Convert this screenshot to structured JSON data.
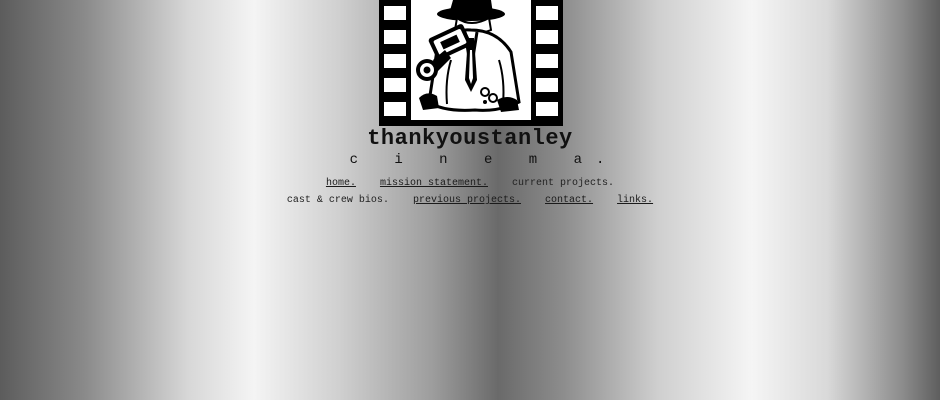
{
  "brand": {
    "title": "thankyoustanley",
    "subtitle": "c i n e m a."
  },
  "logo": {
    "icon": "film-strip-cameraman-logo"
  },
  "nav": {
    "row1": [
      {
        "label": "home.",
        "link": true
      },
      {
        "label": "mission statement.",
        "link": true
      },
      {
        "label": "current projects.",
        "link": false
      }
    ],
    "row2": [
      {
        "label": "cast & crew bios.",
        "link": false
      },
      {
        "label": "previous projects.",
        "link": true
      },
      {
        "label": "contact.",
        "link": true
      },
      {
        "label": "links.",
        "link": true
      }
    ]
  },
  "colors": {
    "text": "#111111",
    "logo_black": "#000000",
    "logo_white": "#ffffff"
  }
}
